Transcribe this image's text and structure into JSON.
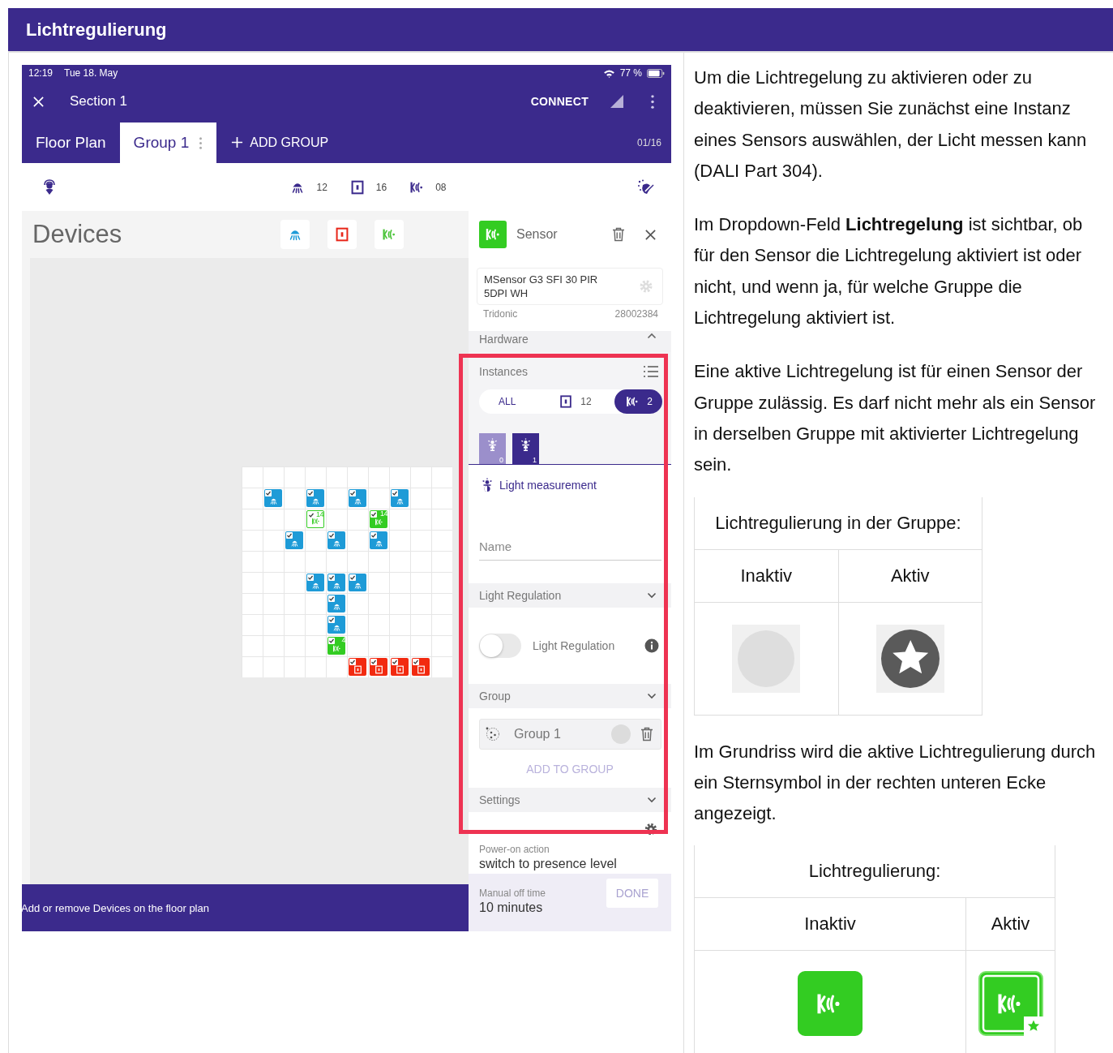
{
  "header": {
    "title": "Lichtregulierung"
  },
  "app": {
    "status_bar": {
      "time": "12:19",
      "date": "Tue 18. May",
      "battery": "77 %"
    },
    "app_bar": {
      "title": "Section 1",
      "action": "CONNECT"
    },
    "tabs": [
      {
        "label": "Floor Plan",
        "selected": false
      },
      {
        "label": "Group 1",
        "selected": true
      }
    ],
    "add_group": "ADD GROUP",
    "page_counter": "01/16",
    "counts": [
      {
        "kind": "lamp",
        "count": "12"
      },
      {
        "kind": "switch",
        "count": "16"
      },
      {
        "kind": "sensor",
        "count": "08"
      }
    ],
    "floor_plan": {
      "title": "Devices",
      "filters": [
        {
          "kind": "lamp"
        },
        {
          "kind": "switch"
        },
        {
          "kind": "sensor"
        }
      ],
      "grid": [
        [
          {
            "kind": "empty"
          },
          {
            "kind": "empty"
          },
          {
            "kind": "empty"
          },
          {
            "kind": "empty"
          },
          {
            "kind": "empty"
          },
          {
            "kind": "empty"
          },
          {
            "kind": "empty"
          },
          {
            "kind": "empty"
          },
          {
            "kind": "empty"
          },
          {
            "kind": "empty"
          }
        ],
        [
          {
            "kind": "empty"
          },
          {
            "kind": "lamp"
          },
          {
            "kind": "empty"
          },
          {
            "kind": "lamp"
          },
          {
            "kind": "empty"
          },
          {
            "kind": "lamp"
          },
          {
            "kind": "empty"
          },
          {
            "kind": "lamp"
          },
          {
            "kind": "empty"
          },
          {
            "kind": "empty"
          }
        ],
        [
          {
            "kind": "empty"
          },
          {
            "kind": "empty"
          },
          {
            "kind": "empty"
          },
          {
            "kind": "sensor-selected",
            "label": "14"
          },
          {
            "kind": "empty"
          },
          {
            "kind": "empty"
          },
          {
            "kind": "sensor",
            "label": "14"
          },
          {
            "kind": "empty"
          },
          {
            "kind": "empty"
          },
          {
            "kind": "empty"
          }
        ],
        [
          {
            "kind": "empty"
          },
          {
            "kind": "empty"
          },
          {
            "kind": "lamp"
          },
          {
            "kind": "empty"
          },
          {
            "kind": "lamp"
          },
          {
            "kind": "empty"
          },
          {
            "kind": "lamp"
          },
          {
            "kind": "empty"
          },
          {
            "kind": "empty"
          },
          {
            "kind": "empty"
          }
        ],
        [
          {
            "kind": "empty"
          },
          {
            "kind": "empty"
          },
          {
            "kind": "empty"
          },
          {
            "kind": "empty"
          },
          {
            "kind": "empty"
          },
          {
            "kind": "empty"
          },
          {
            "kind": "empty"
          },
          {
            "kind": "empty"
          },
          {
            "kind": "empty"
          },
          {
            "kind": "empty"
          }
        ],
        [
          {
            "kind": "empty"
          },
          {
            "kind": "empty"
          },
          {
            "kind": "empty"
          },
          {
            "kind": "lamp"
          },
          {
            "kind": "lamp"
          },
          {
            "kind": "lamp"
          },
          {
            "kind": "empty"
          },
          {
            "kind": "empty"
          },
          {
            "kind": "empty"
          },
          {
            "kind": "empty"
          }
        ],
        [
          {
            "kind": "empty"
          },
          {
            "kind": "empty"
          },
          {
            "kind": "empty"
          },
          {
            "kind": "empty"
          },
          {
            "kind": "lamp"
          },
          {
            "kind": "empty"
          },
          {
            "kind": "empty"
          },
          {
            "kind": "empty"
          },
          {
            "kind": "empty"
          },
          {
            "kind": "empty"
          }
        ],
        [
          {
            "kind": "empty"
          },
          {
            "kind": "empty"
          },
          {
            "kind": "empty"
          },
          {
            "kind": "empty"
          },
          {
            "kind": "lamp"
          },
          {
            "kind": "empty"
          },
          {
            "kind": "empty"
          },
          {
            "kind": "empty"
          },
          {
            "kind": "empty"
          },
          {
            "kind": "empty"
          }
        ],
        [
          {
            "kind": "empty"
          },
          {
            "kind": "empty"
          },
          {
            "kind": "empty"
          },
          {
            "kind": "empty"
          },
          {
            "kind": "sensor",
            "label": "4"
          },
          {
            "kind": "empty"
          },
          {
            "kind": "empty"
          },
          {
            "kind": "empty"
          },
          {
            "kind": "empty"
          },
          {
            "kind": "empty"
          }
        ],
        [
          {
            "kind": "empty"
          },
          {
            "kind": "empty"
          },
          {
            "kind": "empty"
          },
          {
            "kind": "empty"
          },
          {
            "kind": "empty"
          },
          {
            "kind": "switch"
          },
          {
            "kind": "switch"
          },
          {
            "kind": "switch"
          },
          {
            "kind": "switch"
          },
          {
            "kind": "empty"
          }
        ]
      ],
      "hint": "Add or remove Devices on the floor plan"
    },
    "panel": {
      "title": "Sensor",
      "device": {
        "name": "MSensor G3 SFI 30 PIR 5DPI WH",
        "vendor": "Tridonic",
        "article_no": "28002384"
      },
      "hardware": {
        "label": "Hardware",
        "expanded": true
      },
      "instances": {
        "label": "Instances",
        "filters": [
          {
            "kind": "all",
            "label": "ALL",
            "selected": false
          },
          {
            "kind": "switch",
            "label": "12",
            "selected": false
          },
          {
            "kind": "sensor",
            "label": "2",
            "selected": true
          }
        ],
        "items": [
          {
            "number": "0",
            "selected": false
          },
          {
            "number": "1",
            "selected": true
          }
        ]
      },
      "instance_type": "Light measurement",
      "name_placeholder": "Name",
      "light_regulation": {
        "header": "Light Regulation",
        "toggle_label": "Light Regulation",
        "on": false
      },
      "group": {
        "header": "Group",
        "items": [
          {
            "name": "Group 1",
            "regulation_active": false
          }
        ],
        "add_button": "ADD TO GROUP"
      },
      "settings": {
        "header": "Settings",
        "fields": [
          {
            "label": "Power-on action",
            "value": "switch to presence level"
          },
          {
            "label": "Manual off time",
            "value": "10 minutes"
          }
        ]
      },
      "done_button": "DONE"
    }
  },
  "article": {
    "blocks": [
      {
        "kind": "paragraph",
        "text": "Um die Lichtregelung zu aktivieren oder zu deaktivieren, müssen Sie zunächst eine Instanz eines Sensors auswählen, der Licht messen kann (DALI Part 304)."
      },
      {
        "kind": "paragraph",
        "text": "Im Dropdown-Feld **Lichtregelung** ist sichtbar, ob für den Sensor die Lichtregelung aktiviert ist oder nicht, und wenn ja, für welche Gruppe die Lichtregelung aktiviert ist."
      },
      {
        "kind": "paragraph",
        "text": "Eine aktive Lichtregelung ist für einen Sensor der Gruppe zulässig. Es darf nicht mehr als ein Sensor in derselben Gruppe mit aktivierter Lichtregelung sein."
      },
      {
        "kind": "group-table",
        "title": "Lichtregulierung in der Gruppe:",
        "columns": [
          {
            "label": "Inaktiv",
            "active": false
          },
          {
            "label": "Aktiv",
            "active": true
          }
        ]
      },
      {
        "kind": "paragraph",
        "text": "Im Grundriss wird die aktive Lichtregulierung durch ein Sternsymbol in der rechten unteren Ecke angezeigt."
      },
      {
        "kind": "tile-table",
        "title": "Lichtregulierung:",
        "columns": [
          {
            "label": "Inaktiv",
            "active": false
          },
          {
            "label": "Aktiv",
            "active": true
          }
        ]
      }
    ]
  }
}
